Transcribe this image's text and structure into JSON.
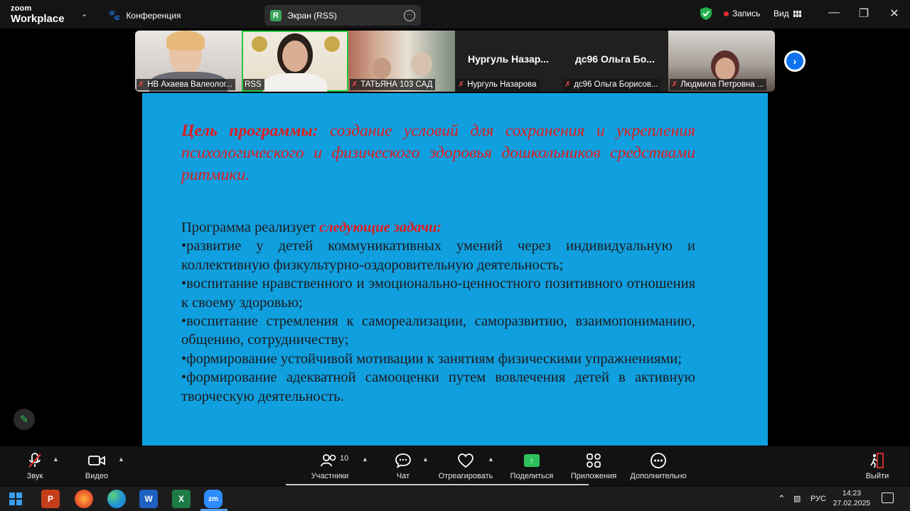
{
  "window": {
    "logo_top": "zoom",
    "logo_bottom": "Workplace",
    "conference_label": "Конференция",
    "screen_badge": "R",
    "screen_label": "Экран (RSS)",
    "record_label": "Запись",
    "view_label": "Вид"
  },
  "participants": [
    {
      "label": "НВ Ахаева Валеолог...",
      "big_name": "",
      "muted": true
    },
    {
      "label": "RSS",
      "big_name": "",
      "muted": false,
      "active": true
    },
    {
      "label": "ТАТЬЯНА 103 САД",
      "big_name": "",
      "muted": true
    },
    {
      "label": "Нургуль Назарова",
      "big_name": "Нургуль  Назар...",
      "muted": true
    },
    {
      "label": "дс96 Ольга  Борисов...",
      "big_name": "дс96  Ольга   Бо...",
      "muted": true
    },
    {
      "label": "Людмила Петровна ...",
      "big_name": "",
      "muted": true
    }
  ],
  "slide": {
    "goal_label": "Цель программы:",
    "goal_text": " создание условий для сохранения и укрепления психологического и физического здоровья дошкольников средствами ритмики.",
    "tasks_intro": "Программа реализует ",
    "tasks_intro_em": "следующие задачи:",
    "tasks": [
      "•развитие у детей коммуникативных умений через индивидуальную и коллективную физкультурно-оздоровительную деятельность;",
      "•воспитание нравственного и эмоционально-ценностного позитивного отношения к своему здоровью;",
      "•воспитание стремления к самореализации, саморазвитию, взаимопониманию, общению, сотрудничеству;",
      "•формирование устойчивой мотивации к занятиям физическими упражнениями;",
      "•формирование адекватной самооценки путем вовлечения детей в активную творческую деятельность."
    ]
  },
  "toolbar": {
    "audio": "Звук",
    "video": "Видео",
    "participants": "Участники",
    "participants_count": "10",
    "chat": "Чат",
    "react": "Отреагировать",
    "share": "Поделиться",
    "apps": "Приложения",
    "more": "Дополнительно",
    "leave": "Выйти"
  },
  "taskbar": {
    "language": "РУС",
    "time": "14:23",
    "date": "27.02.2025"
  },
  "colors": {
    "slide_bg": "#109fdf",
    "goal_red": "#e01c1c",
    "active_green": "#28c840",
    "share_green": "#2ec05c",
    "zoom_blue": "#0e72ed"
  }
}
